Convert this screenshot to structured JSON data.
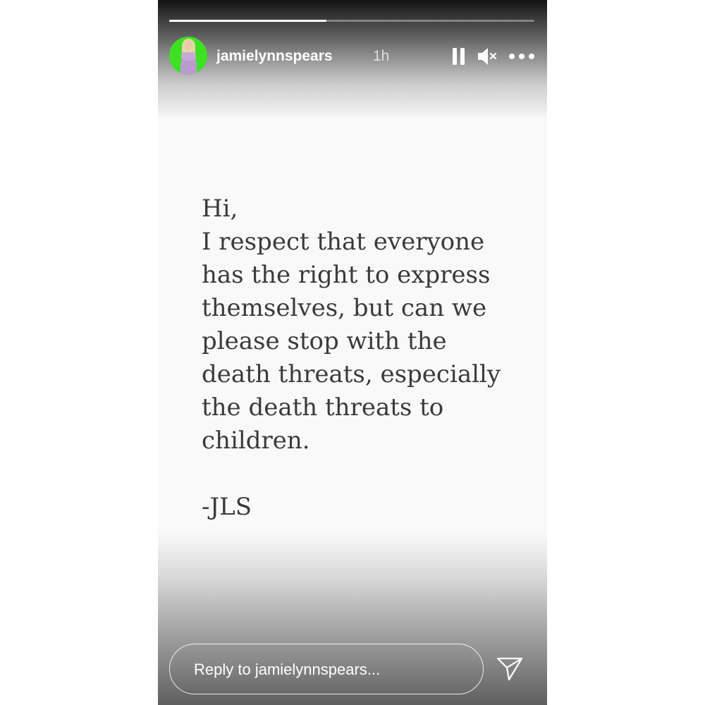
{
  "story": {
    "progress": 0.43,
    "username": "jamielynnspears",
    "time_ago": "1h",
    "avatar_color": "#3ee024"
  },
  "controls": {
    "pause": "pause-icon",
    "mute": "speaker-muted-icon",
    "more": "more-options-icon"
  },
  "message": {
    "lines": [
      "Hi,",
      "I respect that everyone",
      "has the right to express",
      "themselves, but can we",
      "please stop with the",
      "death threats, especially",
      "the death threats to",
      "children."
    ],
    "signature": "-JLS"
  },
  "reply": {
    "placeholder": "Reply to jamielynnspears...",
    "send": "send-icon"
  }
}
